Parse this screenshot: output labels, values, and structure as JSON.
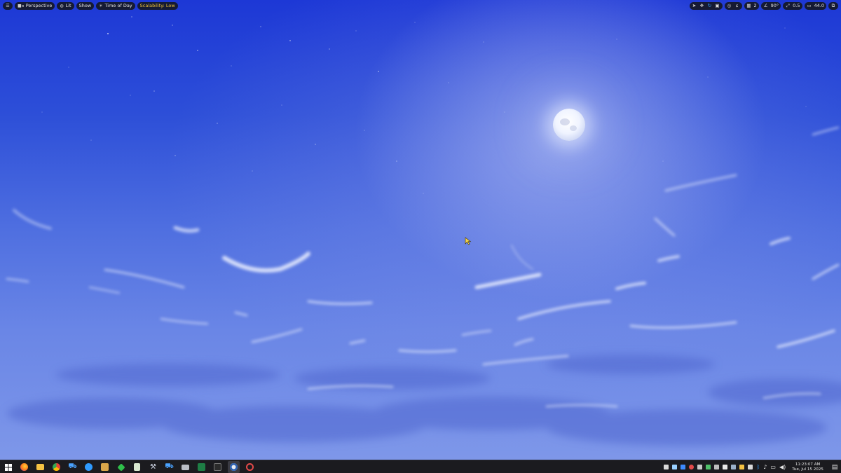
{
  "viewport_toolbar": {
    "menu_icon": "hamburger-icon",
    "perspective_label": "Perspective",
    "lit_label": "Lit",
    "show_label": "Show",
    "time_of_day_label": "Time of Day",
    "scalability_label": "Scalability: Low",
    "scalability_color": "#f2c53b",
    "grid_value": "2",
    "angle_value": "90°",
    "scale_value": "0.5",
    "camera_speed_value": "44.0"
  },
  "taskbar": {
    "clock_time": "11:23:07 AM",
    "clock_date": "Tue, Jul 15 2025"
  },
  "colors": {
    "accent_blue": "#3aa6ff",
    "taskbar_bg": "#1b1b1f"
  }
}
